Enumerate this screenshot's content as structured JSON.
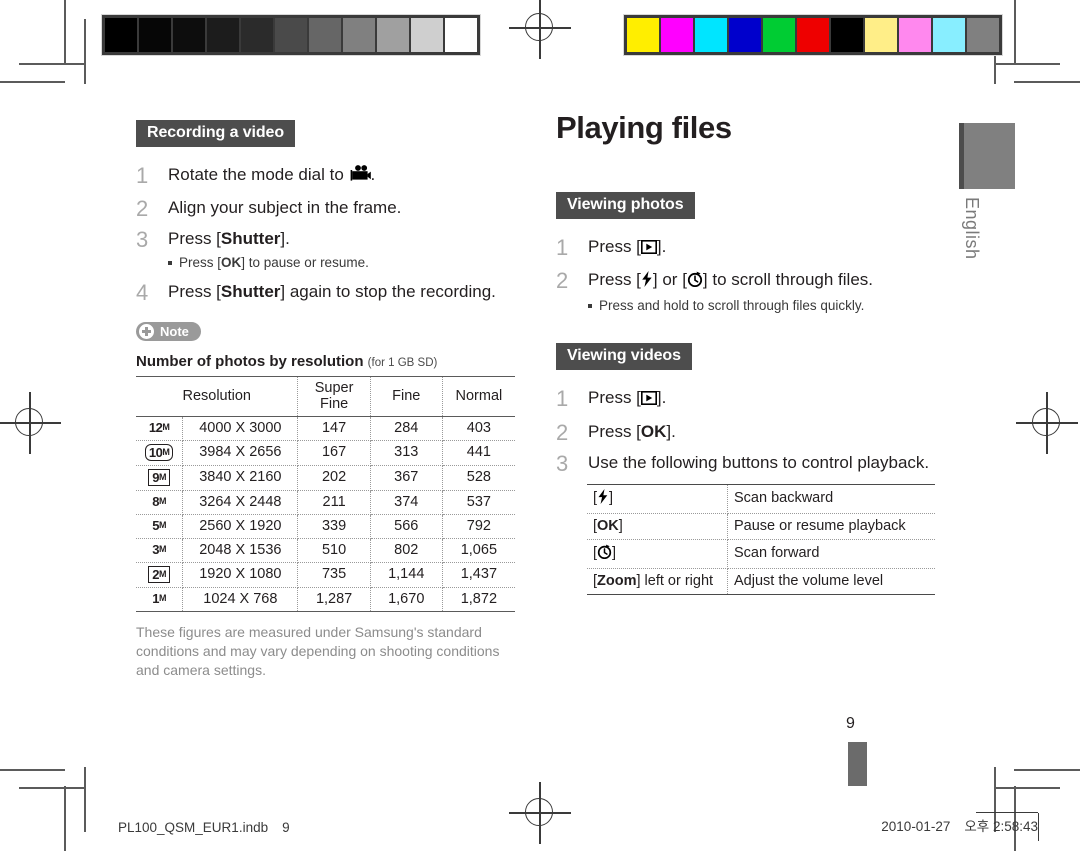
{
  "print_marks": {
    "grayscale_bar": [
      "#000000",
      "#060606",
      "#0d0d0d",
      "#1c1c1c",
      "#2b2b2b",
      "#4a4a4a",
      "#666666",
      "#808080",
      "#a0a0a0",
      "#cfcfcf",
      "#ffffff"
    ],
    "color_bar": [
      "#ffee00",
      "#ff00ff",
      "#00e5ff",
      "#0000cc",
      "#00cc33",
      "#ee0000",
      "#000000",
      "#ffee88",
      "#ff88ee",
      "#88eeff",
      "#808080"
    ]
  },
  "header": {
    "title": "Playing files"
  },
  "side_tab": {
    "language": "English"
  },
  "page_number": "9",
  "left_column": {
    "section": {
      "heading": "Recording a video",
      "steps": [
        {
          "num": "1",
          "text_before": "Rotate the mode dial to ",
          "icon": "movie-camera-icon",
          "text_after": "."
        },
        {
          "num": "2",
          "text_before": "Align your subject in the frame.",
          "icon": "",
          "text_after": ""
        },
        {
          "num": "3",
          "text_before": "Press [",
          "bold": "Shutter",
          "text_after": "].",
          "subnote_before": "Press [",
          "subnote_bold": "OK",
          "subnote_after": "] to pause or resume."
        },
        {
          "num": "4",
          "text_before": "Press [",
          "bold": "Shutter",
          "text_after": "] again to stop the recording."
        }
      ]
    },
    "note": {
      "badge_label": "Note",
      "badge_icon": "plus-circle-icon",
      "title": "Number of photos by resolution",
      "title_small": "(for 1 GB SD)",
      "table": {
        "columns": [
          "Resolution",
          "Super Fine",
          "Fine",
          "Normal"
        ],
        "rows": [
          {
            "code": "12",
            "code_style": "plain",
            "dimensions": "4000 X 3000",
            "super_fine": "147",
            "fine": "284",
            "normal": "403"
          },
          {
            "code": "10",
            "code_style": "rounded",
            "dimensions": "3984 X 2656",
            "super_fine": "167",
            "fine": "313",
            "normal": "441"
          },
          {
            "code": "9",
            "code_style": "boxed",
            "dimensions": "3840 X 2160",
            "super_fine": "202",
            "fine": "367",
            "normal": "528"
          },
          {
            "code": "8",
            "code_style": "plain",
            "dimensions": "3264 X 2448",
            "super_fine": "211",
            "fine": "374",
            "normal": "537"
          },
          {
            "code": "5",
            "code_style": "plain",
            "dimensions": "2560 X 1920",
            "super_fine": "339",
            "fine": "566",
            "normal": "792"
          },
          {
            "code": "3",
            "code_style": "plain",
            "dimensions": "2048 X 1536",
            "super_fine": "510",
            "fine": "802",
            "normal": "1,065"
          },
          {
            "code": "2",
            "code_style": "boxed",
            "dimensions": "1920 X 1080",
            "super_fine": "735",
            "fine": "1,144",
            "normal": "1,437"
          },
          {
            "code": "1",
            "code_style": "plain",
            "dimensions": "1024 X 768",
            "super_fine": "1,287",
            "fine": "1,670",
            "normal": "1,872"
          }
        ]
      },
      "fineprint": "These figures are measured under Samsung's standard conditions and may vary depending on shooting conditions and camera settings."
    }
  },
  "right_column": {
    "viewing_photos": {
      "heading": "Viewing photos",
      "steps": [
        {
          "num": "1",
          "text_before": "Press [",
          "icon": "play-button-icon",
          "text_after": "]."
        },
        {
          "num": "2",
          "text_before": "Press [",
          "icon1": "flash-bolt-icon",
          "text_mid": "] or [",
          "icon2": "timer-icon",
          "text_after": "] to scroll through files.",
          "subnote": "Press and hold to scroll through files quickly."
        }
      ]
    },
    "viewing_videos": {
      "heading": "Viewing videos",
      "steps": [
        {
          "num": "1",
          "text_before": "Press [",
          "icon": "play-button-icon",
          "text_after": "]."
        },
        {
          "num": "2",
          "text_before": "Press [",
          "bold": "OK",
          "text_after": "]."
        },
        {
          "num": "3",
          "text_before": "Use the following buttons to control playback."
        }
      ],
      "playback_table": [
        {
          "key_prefix": "[",
          "key_icon": "flash-bolt-icon",
          "key_suffix": "]",
          "key_bold": "",
          "key_tail": "",
          "action": "Scan backward"
        },
        {
          "key_prefix": "[",
          "key_icon": "",
          "key_bold": "OK",
          "key_suffix": "]",
          "key_tail": "",
          "action": "Pause or resume playback"
        },
        {
          "key_prefix": "[",
          "key_icon": "timer-icon",
          "key_suffix": "]",
          "key_bold": "",
          "key_tail": "",
          "action": "Scan forward"
        },
        {
          "key_prefix": "[",
          "key_icon": "",
          "key_bold": "Zoom",
          "key_suffix": "]",
          "key_tail": " left or right",
          "action": "Adjust the volume level"
        }
      ]
    }
  },
  "footer": {
    "filename": "PL100_QSM_EUR1.indb",
    "page": "9",
    "date": "2010-01-27",
    "time_meridiem": "오후",
    "time": "2:58:43"
  }
}
